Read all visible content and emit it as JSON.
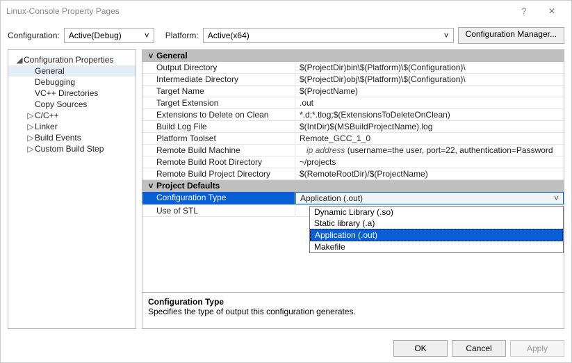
{
  "window": {
    "title": "Linux-Console Property Pages"
  },
  "top": {
    "configLabel": "Configuration:",
    "configValue": "Active(Debug)",
    "platformLabel": "Platform:",
    "platformValue": "Active(x64)",
    "cfgMgr": "Configuration Manager..."
  },
  "tree": {
    "root": "Configuration Properties",
    "items": [
      {
        "label": "General",
        "selected": true
      },
      {
        "label": "Debugging"
      },
      {
        "label": "VC++ Directories"
      },
      {
        "label": "Copy Sources"
      },
      {
        "label": "C/C++",
        "expandable": true
      },
      {
        "label": "Linker",
        "expandable": true
      },
      {
        "label": "Build Events",
        "expandable": true
      },
      {
        "label": "Custom Build Step",
        "expandable": true
      }
    ]
  },
  "sections": {
    "general": "General",
    "defaults": "Project Defaults"
  },
  "props": {
    "outDir": {
      "name": "Output Directory",
      "value": "$(ProjectDir)bin\\$(Platform)\\$(Configuration)\\"
    },
    "intDir": {
      "name": "Intermediate Directory",
      "value": "$(ProjectDir)obj\\$(Platform)\\$(Configuration)\\"
    },
    "tName": {
      "name": "Target Name",
      "value": "$(ProjectName)"
    },
    "tExt": {
      "name": "Target Extension",
      "value": ".out"
    },
    "delExt": {
      "name": "Extensions to Delete on Clean",
      "value": "*.d;*.tlog;$(ExtensionsToDeleteOnClean)"
    },
    "logFile": {
      "name": "Build Log File",
      "value": "$(IntDir)$(MSBuildProjectName).log"
    },
    "toolset": {
      "name": "Platform Toolset",
      "value": "Remote_GCC_1_0"
    },
    "rbm": {
      "name": "Remote Build Machine",
      "ip": "ip address",
      "suffix": "    (username=the user, port=22, authentication=Password"
    },
    "rbrDir": {
      "name": "Remote Build Root Directory",
      "value": "~/projects"
    },
    "rbpDir": {
      "name": "Remote Build Project Directory",
      "value": "$(RemoteRootDir)/$(ProjectName)"
    },
    "cfgType": {
      "name": "Configuration Type",
      "value": "Application (.out)"
    },
    "stl": {
      "name": "Use of STL",
      "value": ""
    }
  },
  "dropdown": {
    "opts": [
      "Dynamic Library (.so)",
      "Static library (.a)",
      "Application (.out)",
      "Makefile"
    ],
    "hl": 2
  },
  "help": {
    "name": "Configuration Type",
    "desc": "Specifies the type of output this configuration generates."
  },
  "buttons": {
    "ok": "OK",
    "cancel": "Cancel",
    "apply": "Apply"
  }
}
